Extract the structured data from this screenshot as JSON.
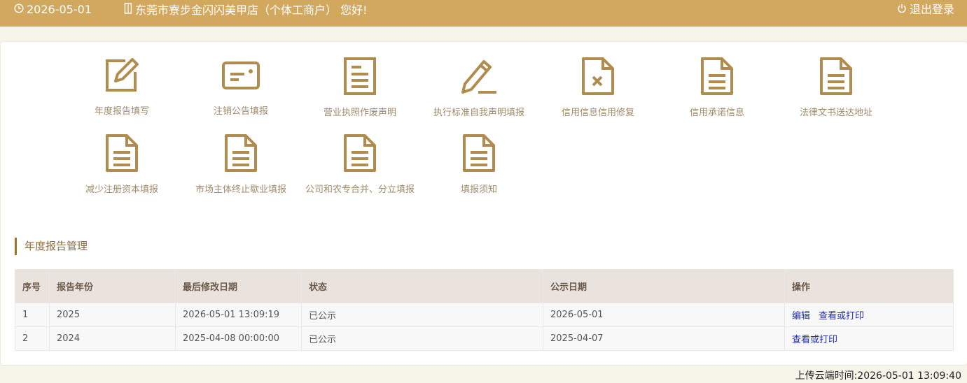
{
  "header": {
    "date": "2026-05-01",
    "greeting": "东莞市寮步金闪闪美甲店（个体工商户） 您好!",
    "logout_label": "退出登录"
  },
  "tiles": [
    {
      "label": "年度报告填写",
      "icon": "edit-square-icon"
    },
    {
      "label": "注销公告填报",
      "icon": "id-card-icon"
    },
    {
      "label": "营业执照作废声明",
      "icon": "document-lines-icon"
    },
    {
      "label": "执行标准自我声明填报",
      "icon": "pencil-icon"
    },
    {
      "label": "信用信息信用修复",
      "icon": "document-x-icon"
    },
    {
      "label": "信用承诺信息",
      "icon": "document-icon"
    },
    {
      "label": "法律文书送达地址",
      "icon": "document-icon"
    },
    {
      "label": "减少注册资本填报",
      "icon": "document-icon"
    },
    {
      "label": "市场主体终止歇业填报",
      "icon": "document-icon"
    },
    {
      "label": "公司和农专合并、分立填报",
      "icon": "document-icon"
    },
    {
      "label": "填报须知",
      "icon": "document-icon"
    }
  ],
  "section": {
    "title": "年度报告管理"
  },
  "table": {
    "headers": [
      "序号",
      "报告年份",
      "最后修改日期",
      "状态",
      "公示日期",
      "操作"
    ],
    "rows": [
      {
        "no": "1",
        "year": "2025",
        "modified": "2026-05-01 13:09:19",
        "status": "已公示",
        "publish": "2026-05-01",
        "actions": [
          "编辑",
          "查看或打印"
        ]
      },
      {
        "no": "2",
        "year": "2024",
        "modified": "2025-04-08 00:00:00",
        "status": "已公示",
        "publish": "2025-04-07",
        "actions": [
          "查看或打印"
        ]
      }
    ]
  },
  "footer": {
    "upload_time": "上传云端时间:2026-05-01 13:09:40"
  },
  "colors": {
    "topbar": "#d1a85e",
    "icon": "#b08c4e",
    "tile_label": "#a08a6a",
    "link": "#1f2db0"
  }
}
